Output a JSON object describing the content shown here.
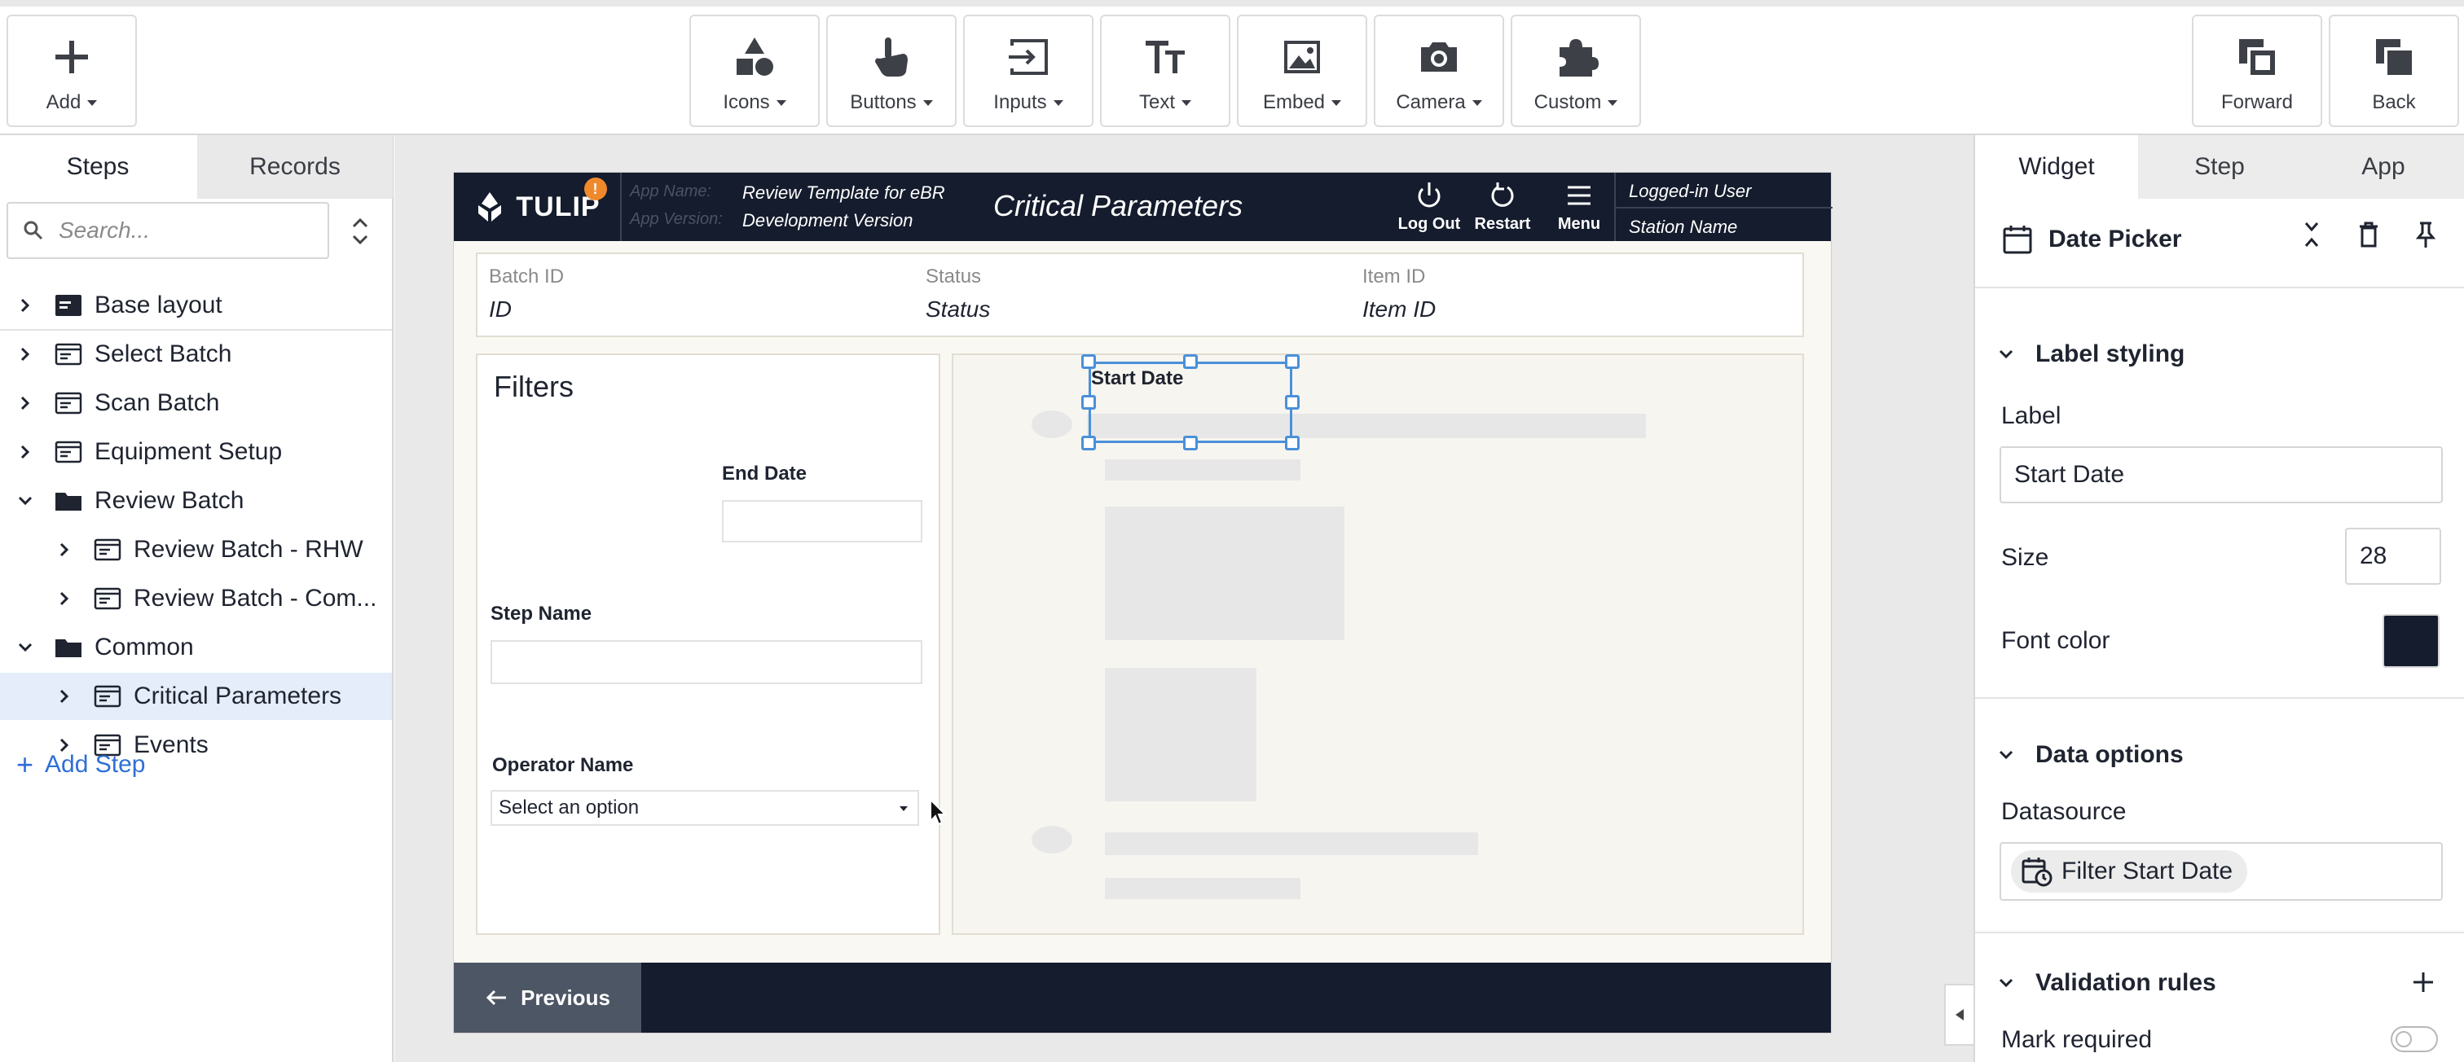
{
  "toolbar": {
    "add": "Add",
    "icons": "Icons",
    "buttons": "Buttons",
    "inputs": "Inputs",
    "text": "Text",
    "embed": "Embed",
    "camera": "Camera",
    "custom": "Custom",
    "forward": "Forward",
    "back": "Back"
  },
  "left_panel": {
    "tabs": [
      "Steps",
      "Records"
    ],
    "active_tab": "Steps",
    "search_placeholder": "Search...",
    "tree": [
      {
        "label": "Base layout",
        "icon": "step-layout-icon",
        "expanded": false,
        "level": 0
      },
      {
        "label": "Select Batch",
        "icon": "step-icon",
        "expanded": false,
        "level": 0
      },
      {
        "label": "Scan Batch",
        "icon": "step-icon",
        "expanded": false,
        "level": 0
      },
      {
        "label": "Equipment Setup",
        "icon": "step-icon",
        "expanded": false,
        "level": 0
      },
      {
        "label": "Review Batch",
        "icon": "folder-icon",
        "expanded": true,
        "level": 0
      },
      {
        "label": "Review Batch - RHW",
        "icon": "step-icon",
        "expanded": false,
        "level": 1
      },
      {
        "label": "Review Batch - Com...",
        "icon": "step-icon",
        "expanded": false,
        "level": 1
      },
      {
        "label": "Common",
        "icon": "folder-icon",
        "expanded": true,
        "level": 0
      },
      {
        "label": "Critical Parameters",
        "icon": "step-icon",
        "expanded": false,
        "level": 1,
        "selected": true
      },
      {
        "label": "Events",
        "icon": "step-icon",
        "expanded": false,
        "level": 1
      }
    ],
    "add_step": "Add Step"
  },
  "app": {
    "logo_text": "TULIP",
    "badge": "!",
    "app_name_label": "App Name:",
    "app_name": "Review Template for eBR",
    "app_version_label": "App Version:",
    "app_version": "Development Version",
    "title": "Critical Parameters",
    "header_buttons": [
      "Log Out",
      "Restart",
      "Menu"
    ],
    "logged_in_user": "Logged-in User",
    "station_name": "Station Name",
    "info": {
      "batch_id_label": "Batch ID",
      "batch_id": "ID",
      "status_label": "Status",
      "status": "Status",
      "item_id_label": "Item ID",
      "item_id": "Item ID"
    },
    "filters": {
      "title": "Filters",
      "end_date_label": "End Date",
      "step_name_label": "Step Name",
      "operator_name_label": "Operator Name",
      "operator_select_value": "Select an option"
    },
    "selected_widget": {
      "label": "Start Date"
    },
    "previous": "Previous"
  },
  "right_panel": {
    "tabs": [
      "Widget",
      "Step",
      "App"
    ],
    "active_tab": "Widget",
    "widget_name": "Date Picker",
    "label_styling": "Label styling",
    "label_field_label": "Label",
    "label_value": "Start Date",
    "size_label": "Size",
    "size_value": "28",
    "font_color_label": "Font color",
    "font_color": "#141c2d",
    "data_options": "Data options",
    "datasource_label": "Datasource",
    "datasource_value": "Filter Start Date",
    "validation_rules": "Validation rules",
    "mark_required": "Mark required",
    "mark_required_on": false
  },
  "colors": {
    "app_header": "#141c2d",
    "selection": "#4a90d9",
    "accent_link": "#2f6fd6",
    "badge": "#f0892c"
  }
}
